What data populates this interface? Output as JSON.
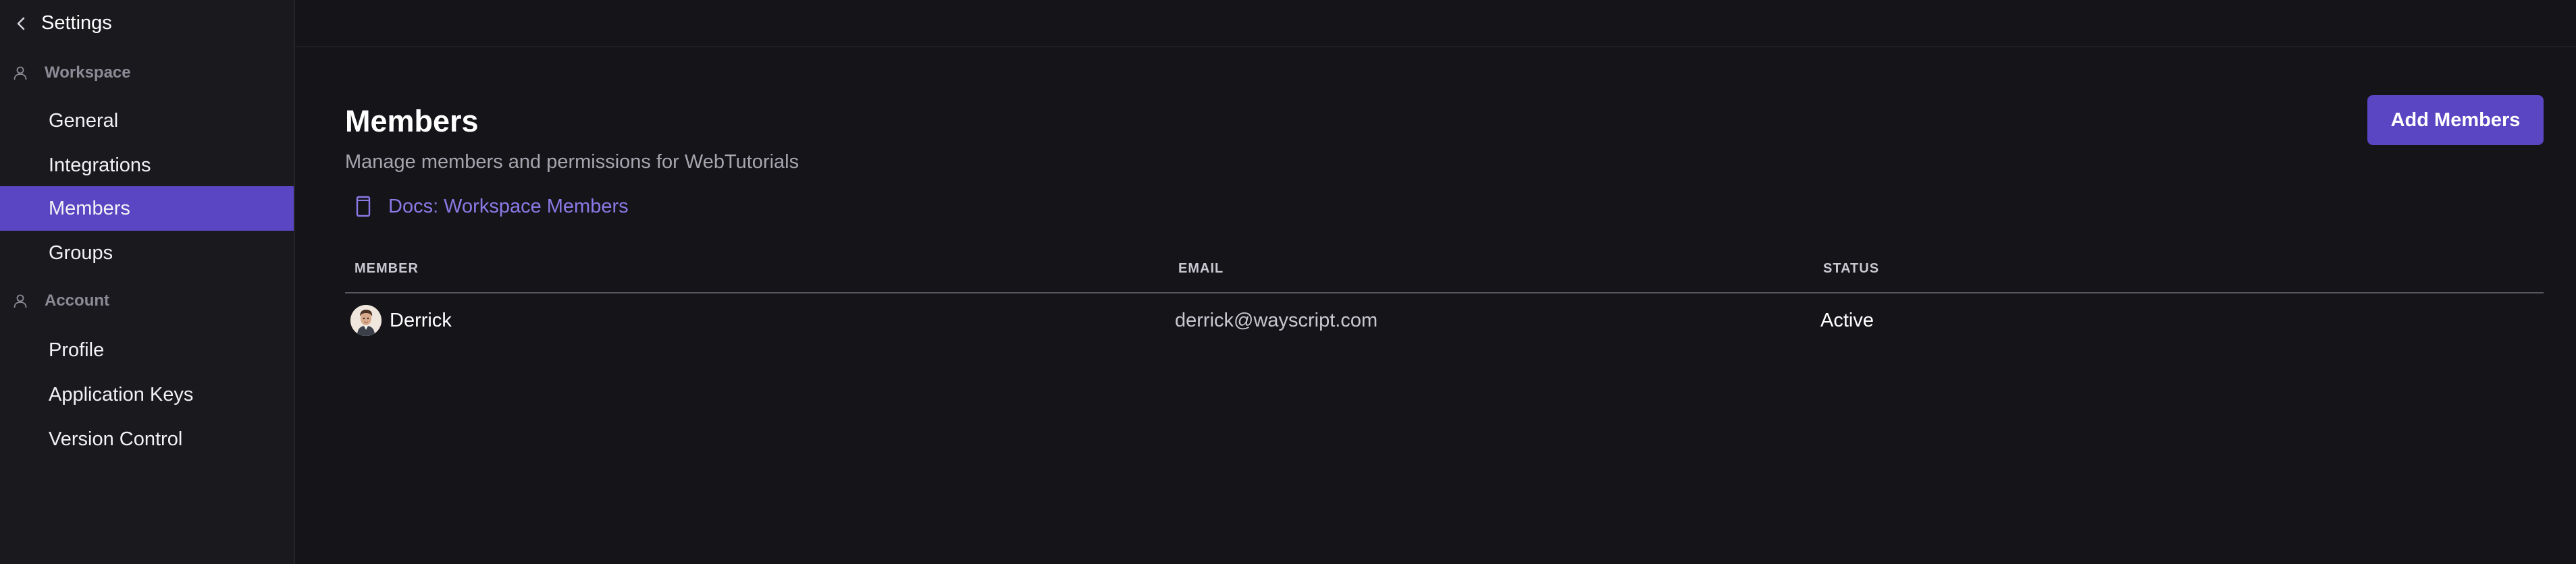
{
  "sidebar": {
    "title": "Settings",
    "sections": [
      {
        "label": "Workspace",
        "icon": "user-icon",
        "items": [
          {
            "label": "General"
          },
          {
            "label": "Integrations"
          },
          {
            "label": "Members",
            "active": true
          },
          {
            "label": "Groups"
          }
        ]
      },
      {
        "label": "Account",
        "icon": "user-icon",
        "items": [
          {
            "label": "Profile"
          },
          {
            "label": "Application Keys"
          },
          {
            "label": "Version Control"
          }
        ]
      }
    ]
  },
  "main": {
    "title": "Members",
    "subtitle": "Manage members and permissions for WebTutorials",
    "docs_link": {
      "label": "Docs: Workspace Members",
      "icon": "document-icon"
    },
    "add_button": "Add Members",
    "table": {
      "columns": [
        "MEMBER",
        "EMAIL",
        "STATUS"
      ],
      "rows": [
        {
          "name": "Derrick",
          "email": "derrick@wayscript.com",
          "status": "Active"
        }
      ]
    }
  },
  "colors": {
    "accent": "#5a45c3",
    "link": "#8b79e6",
    "background": "#151419",
    "sidebar_background": "#1a191e"
  }
}
